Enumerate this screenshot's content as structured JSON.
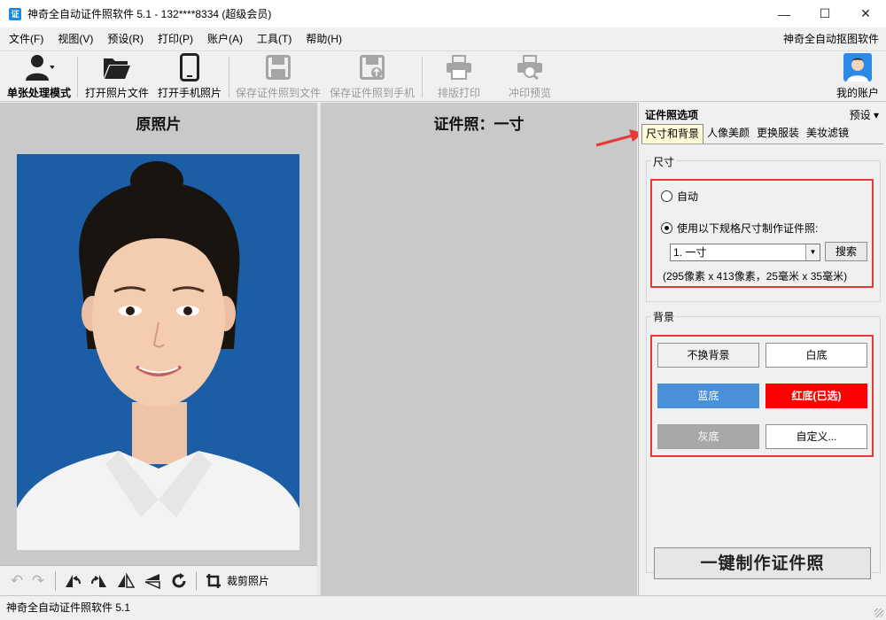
{
  "window": {
    "title": "神奇全自动证件照软件 5.1 - 132****8334 (超级会员)",
    "app_icon_text": "证",
    "minimize": "—",
    "maximize": "☐",
    "close": "✕"
  },
  "menu": {
    "items": [
      {
        "label": "文件(F)"
      },
      {
        "label": "视图(V)"
      },
      {
        "label": "预设(R)"
      },
      {
        "label": "打印(P)"
      },
      {
        "label": "账户(A)"
      },
      {
        "label": "工具(T)"
      },
      {
        "label": "帮助(H)"
      }
    ],
    "right_link": "神奇全自动抠图软件"
  },
  "toolbar": {
    "single_mode": "单张处理模式",
    "open_photo": "打开照片文件",
    "open_phone": "打开手机照片",
    "save_to_file": "保存证件照到文件",
    "save_to_phone": "保存证件照到手机",
    "layout_print": "排版打印",
    "print_preview": "冲印预览",
    "my_account": "我的账户"
  },
  "left_panel": {
    "title": "原照片",
    "crop_label": "裁剪照片"
  },
  "middle_panel": {
    "title": "证件照：一寸"
  },
  "options": {
    "header": "证件照选项",
    "preset": "预设 ▾",
    "tabs": [
      "尺寸和背景",
      "人像美颜",
      "更换服装",
      "美妆滤镜"
    ],
    "size_group": "尺寸",
    "radio_auto": "自动",
    "radio_spec": "使用以下规格尺寸制作证件照:",
    "size_select": "1. 一寸",
    "search_button": "搜索",
    "size_info": "(295像素 x 413像素，25毫米 x 35毫米)",
    "bg_group": "背景",
    "bg_buttons": {
      "keep": "不换背景",
      "white": "白底",
      "blue": "蓝底",
      "red": "红底(已选)",
      "gray": "灰底",
      "custom": "自定义..."
    },
    "make_button": "一键制作证件照"
  },
  "status": {
    "text": "神奇全自动证件照软件 5.1"
  },
  "colors": {
    "photo_bg": "#1c5ea6",
    "bg_blue": "#4a90d9",
    "bg_red": "#ff0000",
    "bg_gray": "#a8a8a8",
    "highlight": "#e53935"
  }
}
